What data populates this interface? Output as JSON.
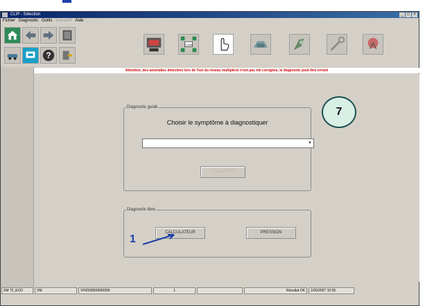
{
  "window": {
    "title": "CLIP - Sélection"
  },
  "window_buttons": [
    "_",
    "□",
    "×"
  ],
  "menu": [
    "Fichier",
    "Diagnostic",
    "Outils",
    "Interactif",
    "Aide"
  ],
  "toolbar_icons": [
    "home-icon",
    "back-arrow-icon",
    "forward-arrow-icon",
    "book-icon",
    "car-network-icon",
    "vehicle-screen-icon",
    "can-network-icon",
    "hand-pointer-icon",
    "tester-icon",
    "engine-icon",
    "wrench-icon",
    "spray-icon",
    "help-icon",
    "exit-icon"
  ],
  "alert": {
    "text": "Attention, des anomalies détectées lors de l'est du réseau multiplexé n'ont pas été corrigées, le diagnostic peut être erroné"
  },
  "guided": {
    "legend": "Diagnostic guidé",
    "prompt": "Choisir le symptôme à diagnostiquer",
    "select_value": "",
    "validate_label": "VALIDATION"
  },
  "free": {
    "legend": "Diagnostic libre",
    "calculator_label": "CALCULATEUR",
    "pressure_label": "PRESSION"
  },
  "badge": "7",
  "callout": "1",
  "status": [
    "XM 72_EVO",
    "XM",
    "VF0000000000000",
    "1",
    "",
    "Résultat OK",
    "1/05/2007 10:05"
  ],
  "colors": {
    "alert": "#cc0000",
    "callout": "#1c3fa8",
    "badge_fill": "#d8efe6"
  }
}
